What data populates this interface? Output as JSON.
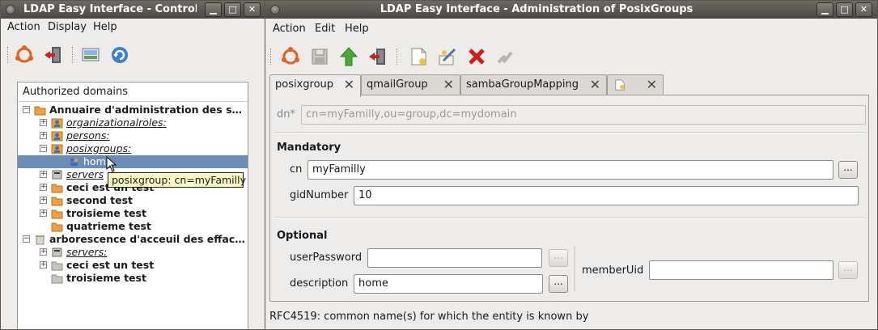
{
  "left_window": {
    "title": "LDAP Easy Interface - Control",
    "menu": [
      "Action",
      "Display",
      "Help"
    ],
    "tree_header": "Authorized domains",
    "tree": [
      {
        "label": "Annuaire d'administration des s…",
        "level": 0,
        "style": "bold",
        "expander": "−",
        "icon": "folder-icon"
      },
      {
        "label": "organizationalroles:",
        "level": 1,
        "style": "italic",
        "expander": "+",
        "icon": "users-icon"
      },
      {
        "label": "persons:",
        "level": 1,
        "style": "italic",
        "expander": "+",
        "icon": "users-icon"
      },
      {
        "label": "posixgroups:",
        "level": 1,
        "style": "italic",
        "expander": "−",
        "icon": "users-icon"
      },
      {
        "label": "home",
        "level": 2,
        "style": "normal",
        "expander": "",
        "icon": "group-icon",
        "selected": true
      },
      {
        "label": "servers",
        "level": 1,
        "style": "italic",
        "expander": "+",
        "icon": "server-icon"
      },
      {
        "label": "ceci est un test",
        "level": 1,
        "style": "bold",
        "expander": "+",
        "icon": "folder-icon"
      },
      {
        "label": "second test",
        "level": 1,
        "style": "bold",
        "expander": "+",
        "icon": "folder-icon"
      },
      {
        "label": "troisieme test",
        "level": 1,
        "style": "bold",
        "expander": "+",
        "icon": "folder-icon"
      },
      {
        "label": "quatrieme test",
        "level": 1,
        "style": "bold",
        "expander": "",
        "icon": "folder-icon"
      },
      {
        "label": "arborescence d'acceuil des effac…",
        "level": 0,
        "style": "bold",
        "expander": "−",
        "icon": "trash-icon"
      },
      {
        "label": "servers:",
        "level": 1,
        "style": "italic",
        "expander": "+",
        "icon": "server-icon"
      },
      {
        "label": "ceci est un test",
        "level": 1,
        "style": "bold",
        "expander": "+",
        "icon": "grey-folder-icon"
      },
      {
        "label": "troisieme test",
        "level": 1,
        "style": "bold",
        "expander": "",
        "icon": "grey-folder-icon"
      }
    ],
    "tooltip": "posixgroup: cn=myFamilly"
  },
  "right_window": {
    "title": "LDAP Easy Interface - Administration of PosixGroups",
    "menu": [
      "Action",
      "Edit",
      "Help"
    ],
    "tabs": [
      "posixgroup",
      "qmailGroup",
      "sambaGroupMapping",
      ""
    ],
    "dn_label": "dn*",
    "dn_value": "cn=myFamilly,ou=group,dc=mydomain",
    "mandatory_heading": "Mandatory",
    "cn_label": "cn",
    "cn_value": "myFamilly",
    "gid_label": "gidNumber",
    "gid_value": "10",
    "optional_heading": "Optional",
    "password_label": "userPassword",
    "password_value": "",
    "description_label": "description",
    "description_value": "home",
    "memberuid_label": "memberUid",
    "memberuid_value": "",
    "ellipsis": "...",
    "status": "RFC4519: common name(s) for which the entity is known by"
  },
  "colors": {
    "selection": "#6c8cb6",
    "tooltip": "#fbf9c6",
    "titlebar": "#4a4843"
  }
}
